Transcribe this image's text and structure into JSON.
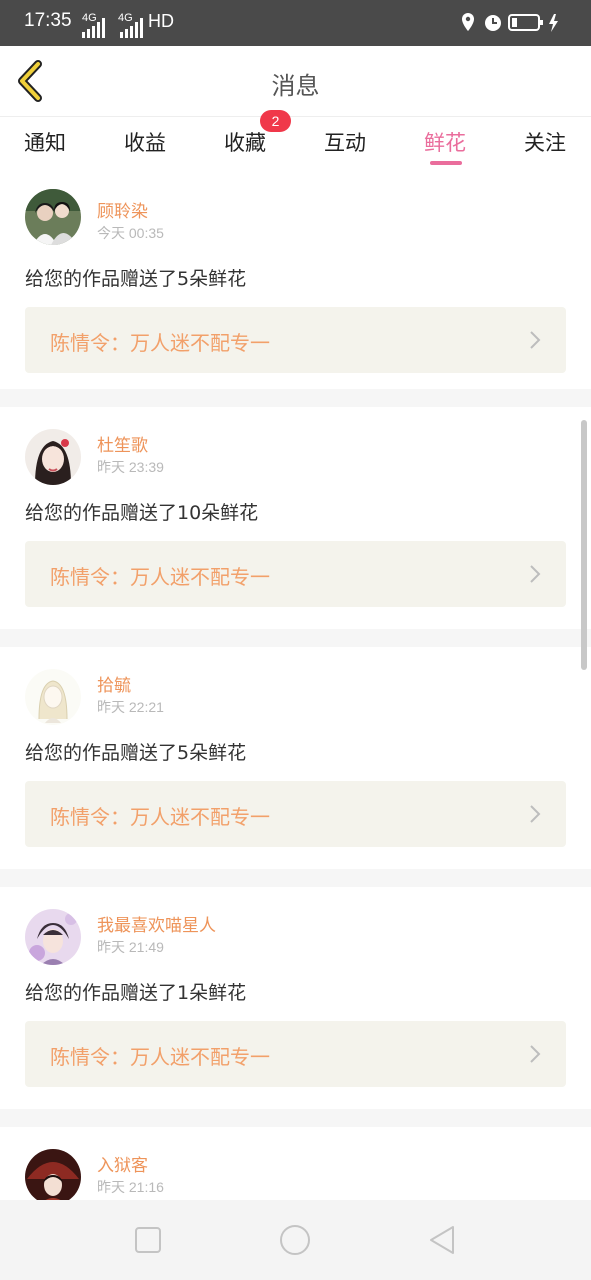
{
  "status_bar": {
    "time": "17:35",
    "net1": "4G",
    "net2": "4G",
    "hd": "HD"
  },
  "header": {
    "title": "消息"
  },
  "tabs": [
    {
      "label": "通知"
    },
    {
      "label": "收益"
    },
    {
      "label": "收藏",
      "badge": "2"
    },
    {
      "label": "互动"
    },
    {
      "label": "鲜花",
      "active": true
    },
    {
      "label": "关注"
    }
  ],
  "messages": [
    {
      "user": "顾聆染",
      "time": "今天 00:35",
      "text": "给您的作品赠送了5朵鲜花",
      "work": "陈情令：万人迷不配专一",
      "avatar_icon": "avatar-couple-photo"
    },
    {
      "user": "杜笙歌",
      "time": "昨天 23:39",
      "text": "给您的作品赠送了10朵鲜花",
      "work": "陈情令：万人迷不配专一",
      "avatar_icon": "avatar-girl-photo"
    },
    {
      "user": "拾毓",
      "time": "昨天 22:21",
      "text": "给您的作品赠送了5朵鲜花",
      "work": "陈情令：万人迷不配专一",
      "avatar_icon": "avatar-sketch"
    },
    {
      "user": "我最喜欢喵星人",
      "time": "昨天 21:49",
      "text": "给您的作品赠送了1朵鲜花",
      "work": "陈情令：万人迷不配专一",
      "avatar_icon": "avatar-anime-boy"
    },
    {
      "user": "入狱客",
      "time": "昨天 21:16",
      "text": "",
      "work": "",
      "avatar_icon": "avatar-anime-red"
    }
  ],
  "colors": {
    "accent": "#ea6d9c",
    "username": "#ee945a",
    "work_title": "#f2a06a",
    "badge": "#f0384a",
    "back_arrow": "#f0d03a"
  }
}
